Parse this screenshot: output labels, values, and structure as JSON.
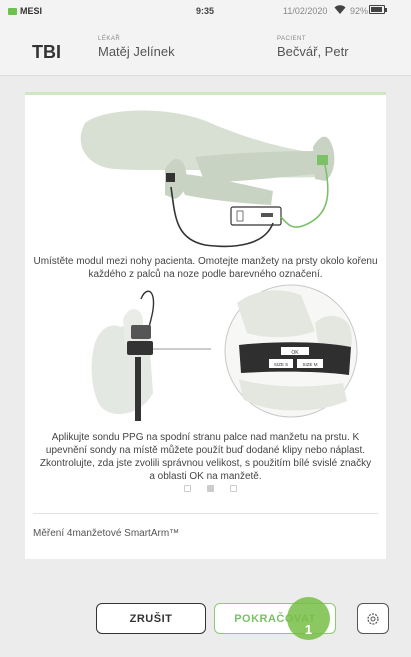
{
  "status_bar": {
    "brand": "MESI",
    "time": "9:35",
    "date": "11/02/2020",
    "battery": "92%",
    "battery_level": 0.92
  },
  "header": {
    "code": "TBI",
    "doctor_label": "LÉKAŘ",
    "doctor_name": "Matěj Jelínek",
    "patient_label": "PACIENT",
    "patient_name": "Bečvář, Petr"
  },
  "instructions": {
    "step1": "Umístěte modul mezi nohy pacienta. Omotejte manžety na prsty okolo kořenu každého z palců na noze podle barevného označení.",
    "step2": "Aplikujte sondu PPG na spodní stranu palce nad manžetu na prstu. K upevnění sondy na místě můžete použít buď dodané klipy nebo náplast. Zkontrolujte, zda jste zvolili správnou velikost, s použitím bílé svislé značky a oblasti OK na manžetě.",
    "cuff_labels": [
      "OK",
      "SIZE S",
      "SIZE M"
    ],
    "pages": 3,
    "active_page": 2
  },
  "measurement_label": "Měření 4manžetové SmartArm™",
  "buttons": {
    "cancel": "ZRUŠIT",
    "continue": "POKRAČOVAT"
  },
  "badge": "1",
  "colors": {
    "accent_green": "#7cc167",
    "badge_green": "#78be46",
    "dark": "#333333"
  },
  "icons": {
    "settings": "gear-icon",
    "wifi": "wifi-icon",
    "battery": "battery-icon"
  }
}
